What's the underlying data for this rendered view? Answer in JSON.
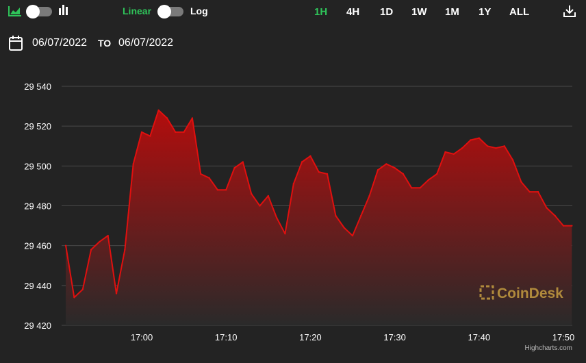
{
  "controls": {
    "scale_left": "Linear",
    "scale_right": "Log",
    "ranges": [
      "1H",
      "4H",
      "1D",
      "1W",
      "1M",
      "1Y",
      "ALL"
    ],
    "active_range": "1H",
    "icons": [
      "area-chart-icon",
      "bar-chart-icon",
      "download-icon",
      "calendar-icon"
    ],
    "accent": "#2fc45a"
  },
  "dates": {
    "from": "06/07/2022",
    "to_label": "TO",
    "to": "06/07/2022"
  },
  "watermark": "CoinDesk",
  "credit": "Highcharts.com",
  "chart_data": {
    "type": "area",
    "title": "",
    "xlabel": "",
    "ylabel": "",
    "line_color": "#e0100f",
    "ylim": [
      29420,
      29540
    ],
    "yticks": [
      29420,
      29440,
      29460,
      29480,
      29500,
      29520,
      29540
    ],
    "ytick_labels": [
      "29 420",
      "29 440",
      "29 460",
      "29 480",
      "29 500",
      "29 520",
      "29 540"
    ],
    "xticks": [
      0,
      10,
      20,
      30,
      40,
      50
    ],
    "xtick_labels": [
      "17:00",
      "17:10",
      "17:20",
      "17:30",
      "17:40",
      "17:50"
    ],
    "grid": true,
    "series": [
      {
        "x": [
          -9,
          -8,
          -7,
          -6,
          -5,
          -4,
          -3,
          -2,
          -1,
          0,
          1,
          2,
          3,
          4,
          5,
          6,
          7,
          8,
          9,
          10,
          11,
          12,
          13,
          14,
          15,
          16,
          17,
          18,
          19,
          20,
          21,
          22,
          23,
          24,
          25,
          26,
          27,
          28,
          29,
          30,
          31,
          32,
          33,
          34,
          35,
          36,
          37,
          38,
          39,
          40,
          41,
          42,
          43,
          44,
          45,
          46,
          47,
          48,
          49,
          50,
          51
        ],
        "values": [
          29460,
          29434,
          29438,
          29458,
          29462,
          29465,
          29436,
          29458,
          29501,
          29517,
          29515,
          29528,
          29524,
          29517,
          29517,
          29524,
          29496,
          29494,
          29488,
          29488,
          29499,
          29502,
          29486,
          29480,
          29485,
          29474,
          29466,
          29491,
          29502,
          29505,
          29497,
          29496,
          29475,
          29469,
          29465,
          29475,
          29485,
          29498,
          29501,
          29499,
          29496,
          29489,
          29489,
          29493,
          29496,
          29507,
          29506,
          29509,
          29513,
          29514,
          29510,
          29509,
          29510,
          29503,
          29492,
          29487,
          29487,
          29479,
          29475,
          29470,
          29470
        ]
      }
    ]
  }
}
